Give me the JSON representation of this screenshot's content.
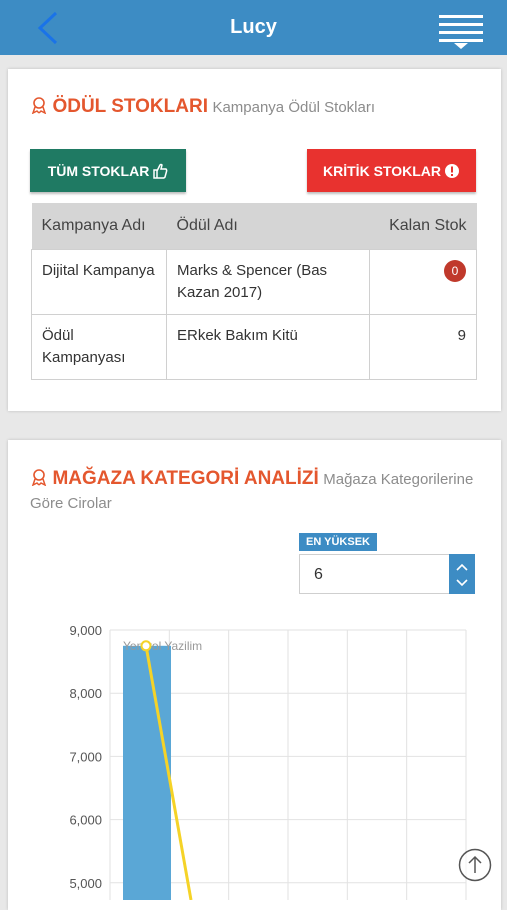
{
  "header": {
    "title": "Lucy"
  },
  "stock_section": {
    "title": "ÖDÜL STOKLARI",
    "subtitle": "Kampanya Ödül Stokları",
    "btn_all": "TÜM STOKLAR",
    "btn_critical": "KRİTİK STOKLAR",
    "columns": [
      "Kampanya Adı",
      "Ödül Adı",
      "Kalan Stok"
    ],
    "rows": [
      {
        "campaign": "Dijital Kampanya",
        "reward": "Marks & Spencer (Bas Kazan 2017)",
        "stock": "0"
      },
      {
        "campaign": "Ödül Kampanyası",
        "reward": "ERkek Bakım Kitü",
        "stock": "9"
      }
    ]
  },
  "category_section": {
    "title": "MAĞAZA KATEGORİ ANALİZİ",
    "subtitle": "Mağaza Kategorilerine Göre Cirolar",
    "select_label": "EN YÜKSEK",
    "select_value": "6"
  },
  "colors": {
    "header": "#3d8cc4",
    "accent": "#e4572e",
    "btn_all": "#1f7a63",
    "btn_critical": "#e8322f",
    "bar": "#5aa7d6",
    "line": "#f5d327"
  },
  "chart_data": {
    "type": "bar",
    "categories": [
      "Yeniyol Yazilim"
    ],
    "values": [
      8750
    ],
    "line_values": [
      8750
    ],
    "y_ticks": [
      "9,000",
      "8,000",
      "7,000",
      "6,000",
      "5,000"
    ],
    "ylim": [
      5000,
      9000
    ],
    "grid": true
  }
}
